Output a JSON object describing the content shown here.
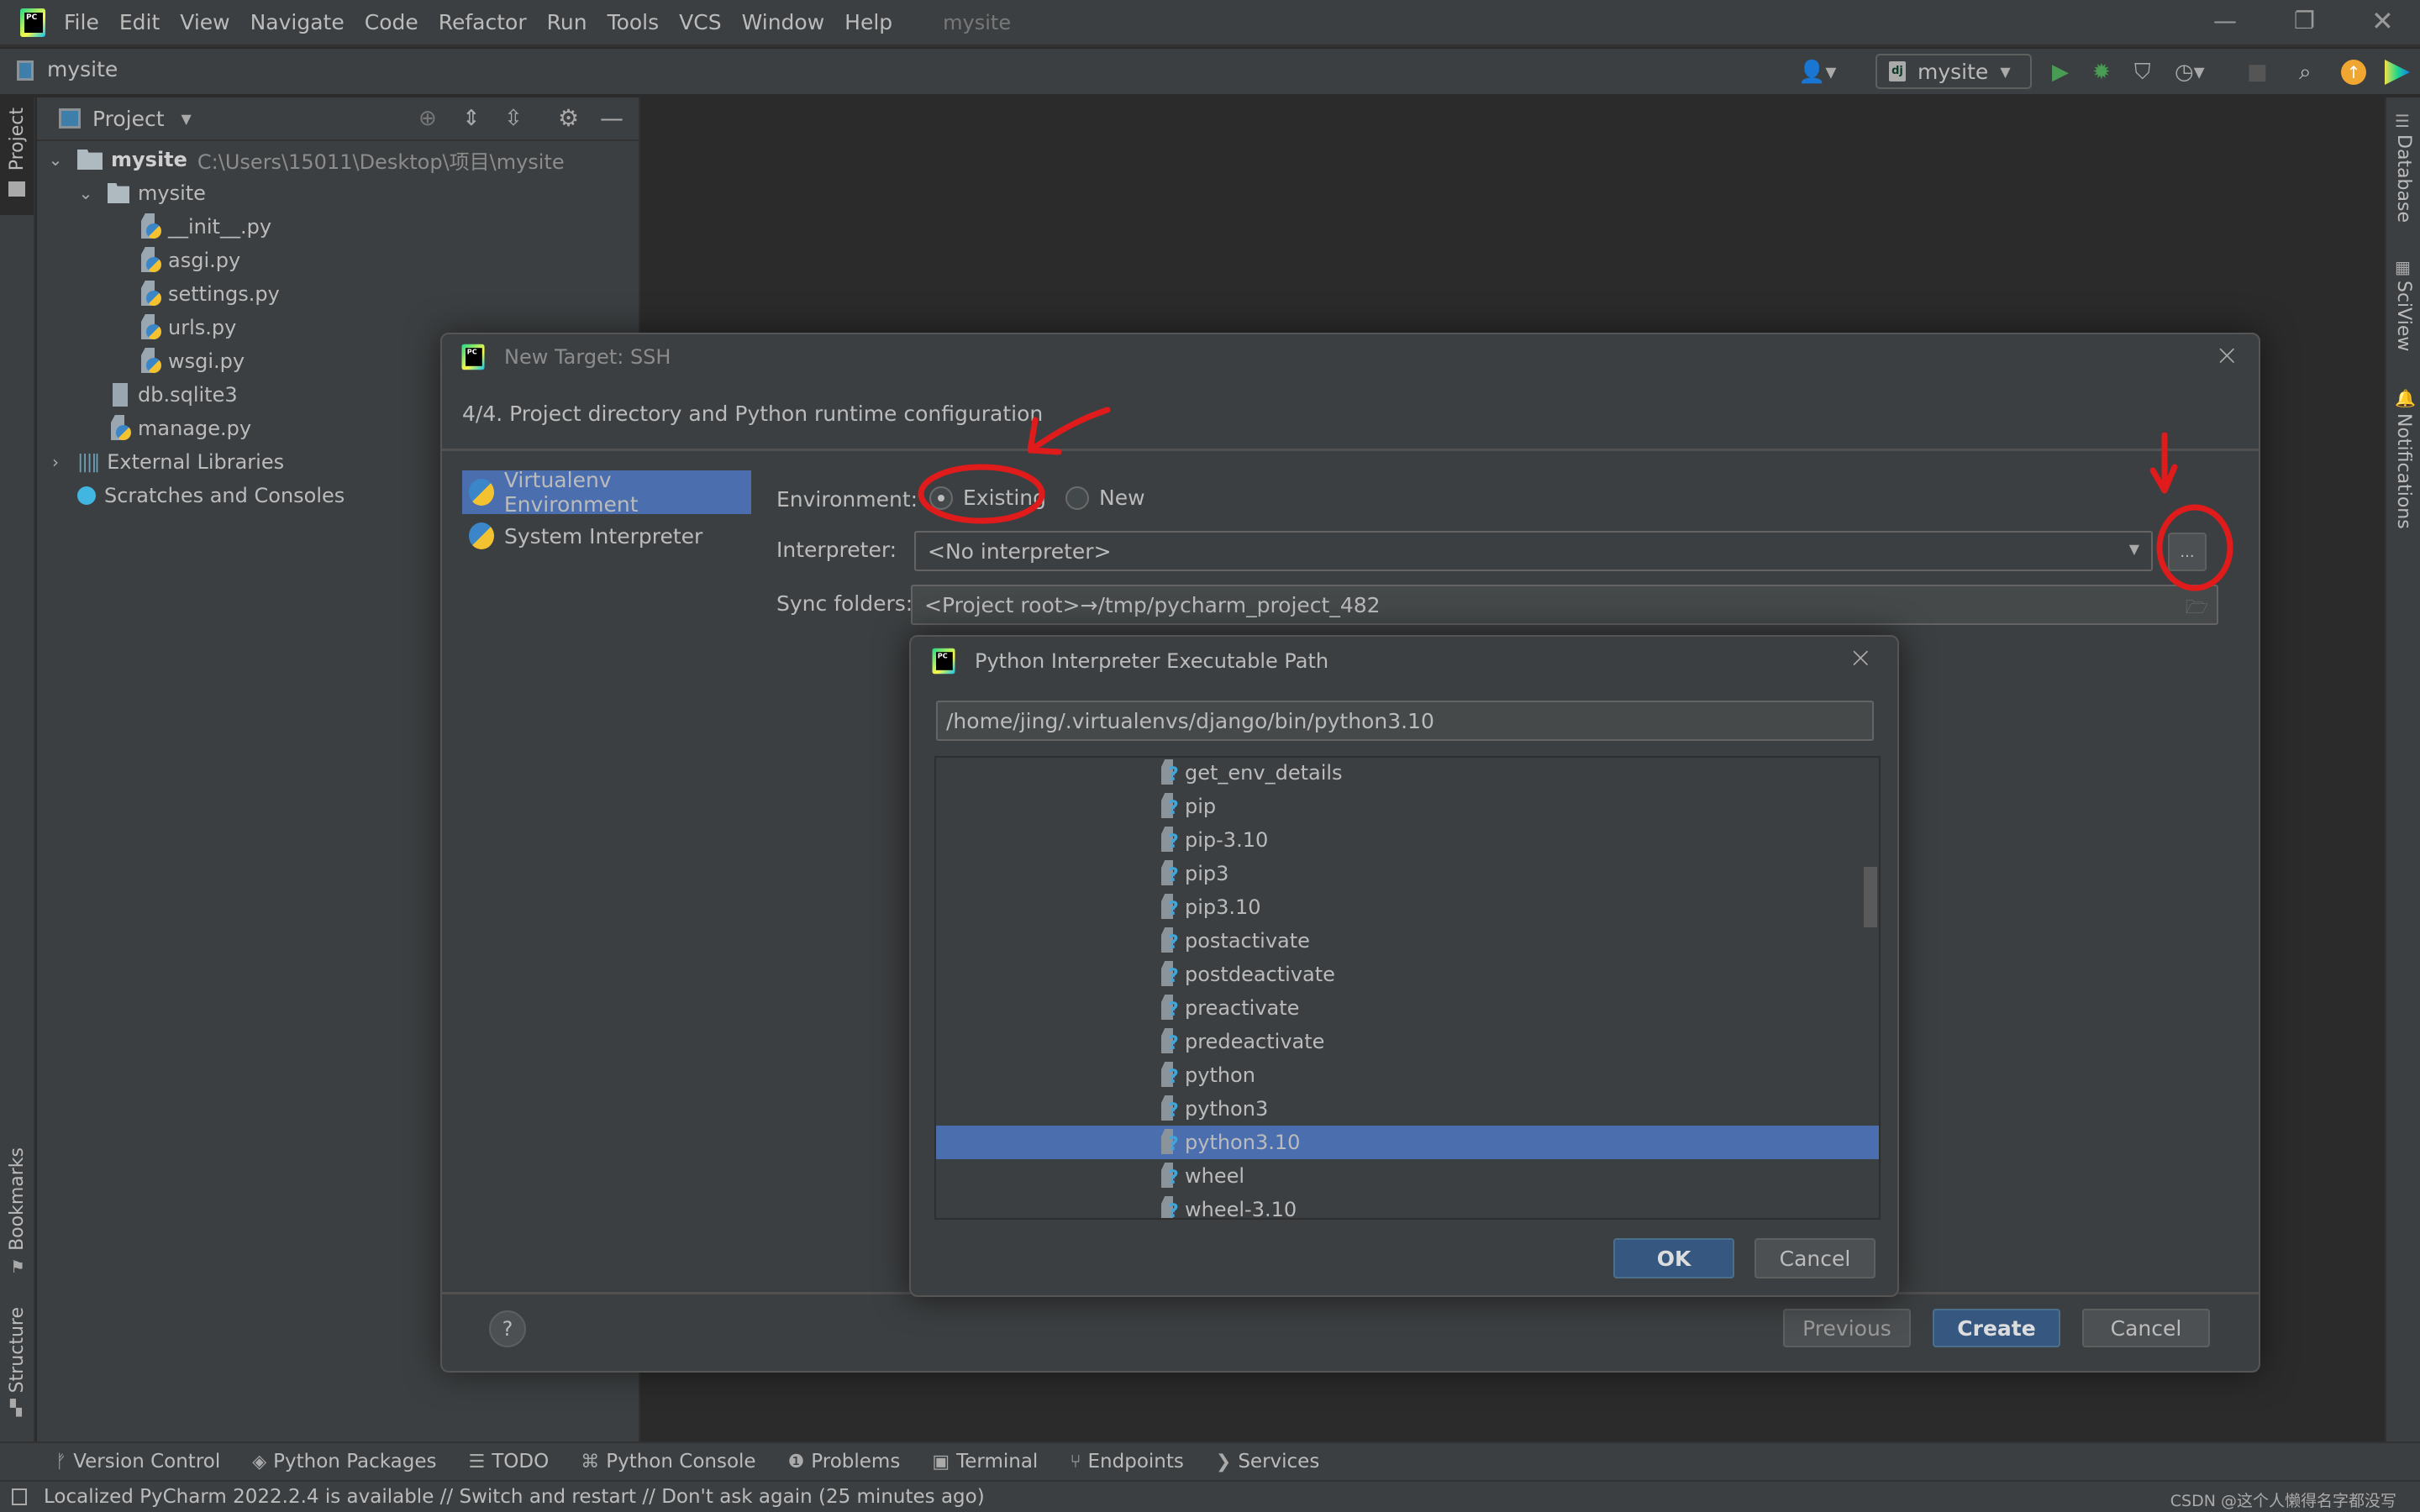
{
  "menubar": {
    "items": [
      "File",
      "Edit",
      "View",
      "Navigate",
      "Code",
      "Refactor",
      "Run",
      "Tools",
      "VCS",
      "Window",
      "Help"
    ],
    "project_title": "mysite",
    "window_controls": {
      "minimize": "minimize-icon",
      "restore": "restore-icon",
      "close": "close-icon"
    }
  },
  "navbar": {
    "breadcrumb": "mysite",
    "run_config": "mysite",
    "icons": [
      "user-icon",
      "run-icon",
      "debug-icon",
      "coverage-icon",
      "profile-icon",
      "stop-icon",
      "search-icon",
      "update-icon",
      "toolbox-icon"
    ]
  },
  "left_strip": {
    "top_tab": "Project",
    "bottom_tabs": [
      "Bookmarks",
      "Structure"
    ]
  },
  "right_strip": {
    "tabs": [
      "Database",
      "SciView",
      "Notifications"
    ]
  },
  "project_panel": {
    "header": "Project",
    "tree": [
      {
        "label": "mysite",
        "path": "C:\\Users\\15011\\Desktop\\项目\\mysite",
        "type": "root",
        "expanded": true
      },
      {
        "label": "mysite",
        "type": "package",
        "expanded": true
      },
      {
        "label": "__init__.py",
        "type": "py"
      },
      {
        "label": "asgi.py",
        "type": "py"
      },
      {
        "label": "settings.py",
        "type": "py"
      },
      {
        "label": "urls.py",
        "type": "py"
      },
      {
        "label": "wsgi.py",
        "type": "py"
      },
      {
        "label": "db.sqlite3",
        "type": "file"
      },
      {
        "label": "manage.py",
        "type": "py"
      },
      {
        "label": "External Libraries",
        "type": "libs",
        "expanded": false
      },
      {
        "label": "Scratches and Consoles",
        "type": "scratches"
      }
    ]
  },
  "main_dialog": {
    "title": "New Target: SSH",
    "step": "4/4. Project directory and Python runtime configuration",
    "sidebar": [
      {
        "label": "Virtualenv Environment",
        "selected": true
      },
      {
        "label": "System Interpreter",
        "selected": false
      }
    ],
    "environment_label": "Environment:",
    "environment_options": [
      {
        "label": "Existing",
        "checked": true
      },
      {
        "label": "New",
        "checked": false
      }
    ],
    "interpreter_label": "Interpreter:",
    "interpreter_value": "<No interpreter>",
    "browse_label": "...",
    "sync_label": "Sync folders:",
    "sync_value": "<Project root>→/tmp/pycharm_project_482",
    "buttons": {
      "previous": "Previous",
      "create": "Create",
      "cancel": "Cancel"
    },
    "help_label": "?"
  },
  "sub_dialog": {
    "title": "Python Interpreter Executable Path",
    "path_value": "/home/jing/.virtualenvs/django/bin/python3.10",
    "files": [
      "get_env_details",
      "pip",
      "pip-3.10",
      "pip3",
      "pip3.10",
      "postactivate",
      "postdeactivate",
      "preactivate",
      "predeactivate",
      "python",
      "python3",
      "python3.10",
      "wheel",
      "wheel-3.10"
    ],
    "selected_file": "python3.10",
    "buttons": {
      "ok": "OK",
      "cancel": "Cancel"
    }
  },
  "bottom_tools": [
    "Version Control",
    "Python Packages",
    "TODO",
    "Python Console",
    "Problems",
    "Terminal",
    "Endpoints",
    "Services"
  ],
  "statusbar": {
    "message": "Localized PyCharm 2022.2.4 is available // Switch and restart // Don't ask again (25 minutes ago)",
    "watermark": "CSDN @这个人懒得名字都没写"
  },
  "annotation_color": "#e01b1b",
  "accent_color": "#4b6eaf"
}
